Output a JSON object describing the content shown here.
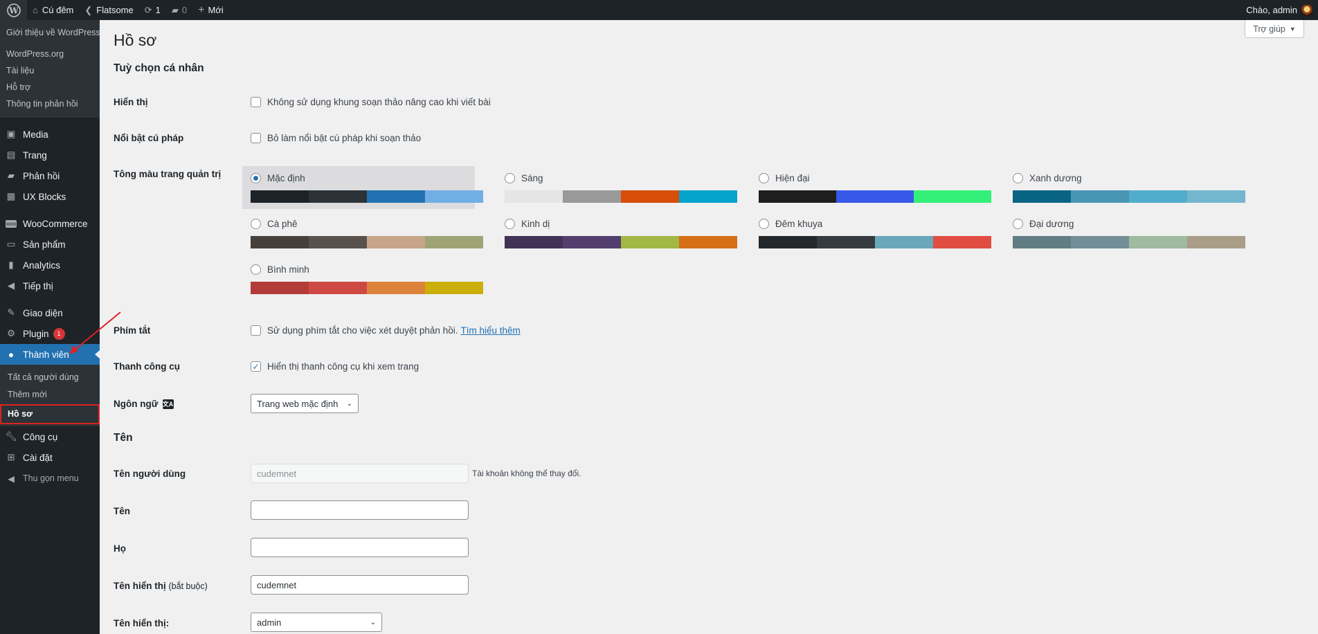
{
  "adminbar": {
    "site_name": "Cú đêm",
    "theme": "Flatsome",
    "updates_count": "1",
    "comments_count": "0",
    "new_label": "Mới",
    "greeting": "Chào, admin"
  },
  "sidebar": {
    "wp_submenu": [
      "Giới thiệu về WordPress",
      "WordPress.org",
      "Tài liệu",
      "Hỗ trợ",
      "Thông tin phản hồi"
    ],
    "items": [
      {
        "label": "Media",
        "icon": "media-icon"
      },
      {
        "label": "Trang",
        "icon": "pages-icon"
      },
      {
        "label": "Phản hồi",
        "icon": "comments-icon"
      },
      {
        "label": "UX Blocks",
        "icon": "blocks-icon"
      },
      {
        "label": "WooCommerce",
        "icon": "woocommerce-icon"
      },
      {
        "label": "Sản phẩm",
        "icon": "products-icon"
      },
      {
        "label": "Analytics",
        "icon": "analytics-icon"
      },
      {
        "label": "Tiếp thị",
        "icon": "marketing-icon"
      },
      {
        "label": "Giao diện",
        "icon": "appearance-icon"
      },
      {
        "label": "Plugin",
        "icon": "plugins-icon",
        "badge": "1"
      },
      {
        "label": "Thành viên",
        "icon": "users-icon"
      },
      {
        "label": "Công cụ",
        "icon": "tools-icon"
      },
      {
        "label": "Cài đặt",
        "icon": "settings-icon"
      }
    ],
    "users_submenu": [
      "Tất cả người dùng",
      "Thêm mới",
      "Hồ sơ"
    ],
    "collapse_label": "Thu gọn menu"
  },
  "help_label": "Trợ giúp",
  "page_title": "Hồ sơ",
  "section_personal": "Tuỳ chọn cá nhân",
  "section_name": "Tên",
  "fields": {
    "visual_label": "Hiển thị",
    "visual_cb": "Không sử dụng khung soạn thảo nâng cao khi viết bài",
    "syntax_label": "Nổi bật cú pháp",
    "syntax_cb": "Bỏ làm nổi bật cú pháp khi soạn thảo",
    "scheme_label": "Tông màu trang quản trị",
    "shortcuts_label": "Phím tắt",
    "shortcuts_cb": "Sử dụng phím tắt cho việc xét duyệt phản hồi.",
    "shortcuts_link": "Tìm hiểu thêm",
    "toolbar_label": "Thanh công cụ",
    "toolbar_cb": "Hiển thị thanh công cụ khi xem trang",
    "language_label": "Ngôn ngữ",
    "language_value": "Trang web mặc định",
    "username_label": "Tên người dùng",
    "username_value": "cudemnet",
    "username_note": "Tài khoản không thể thay đổi.",
    "first_name_label": "Tên",
    "first_name_value": "",
    "last_name_label": "Họ",
    "last_name_value": "",
    "nickname_label": "Tên hiển thị",
    "nickname_required": "(bắt buộc)",
    "nickname_value": "cudemnet",
    "display_name_label": "Tên hiển thị:",
    "display_name_value": "admin"
  },
  "schemes": [
    {
      "name": "Mặc định",
      "selected": true,
      "colors": [
        "#1d2327",
        "#2c3338",
        "#2271b1",
        "#72aee6"
      ]
    },
    {
      "name": "Sáng",
      "selected": false,
      "colors": [
        "#e5e5e5",
        "#999999",
        "#d64e07",
        "#04a4cc"
      ]
    },
    {
      "name": "Hiện đại",
      "selected": false,
      "colors": [
        "#1e1e1e",
        "#3858e9",
        "#33f078"
      ]
    },
    {
      "name": "Xanh dương",
      "selected": false,
      "colors": [
        "#096484",
        "#4796b3",
        "#52accc",
        "#74b6ce"
      ]
    },
    {
      "name": "Cà phê",
      "selected": false,
      "colors": [
        "#46403c",
        "#59524c",
        "#c7a589",
        "#9ea476"
      ]
    },
    {
      "name": "Kinh dị",
      "selected": false,
      "colors": [
        "#413256",
        "#523f6d",
        "#a3b745",
        "#d46f15"
      ]
    },
    {
      "name": "Đêm khuya",
      "selected": false,
      "colors": [
        "#25282b",
        "#363b3f",
        "#69a8bb",
        "#e14d43"
      ]
    },
    {
      "name": "Đại dương",
      "selected": false,
      "colors": [
        "#627c83",
        "#738e96",
        "#9ebaa0",
        "#aa9d88"
      ]
    },
    {
      "name": "Bình minh",
      "selected": false,
      "colors": [
        "#b43c38",
        "#cf4944",
        "#dd823b",
        "#ccaf0b"
      ]
    }
  ]
}
